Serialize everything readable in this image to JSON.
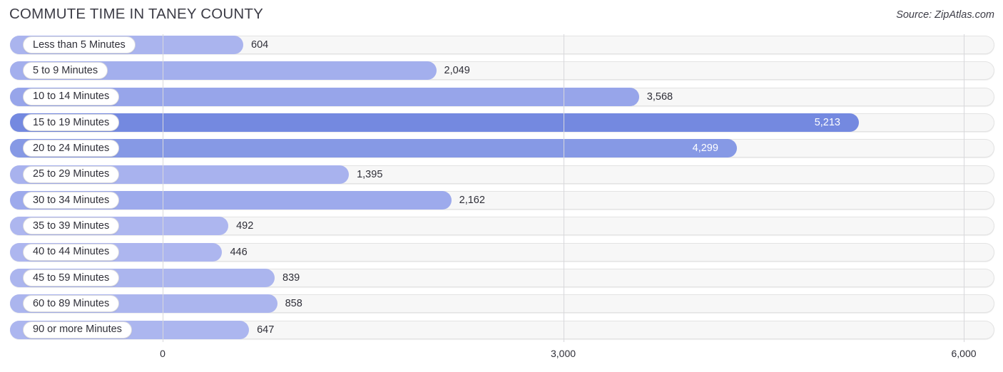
{
  "header": {
    "title": "COMMUTE TIME IN TANEY COUNTY",
    "source": "Source: ZipAtlas.com"
  },
  "colors": {
    "bar_light": "#aab4ee",
    "bar_mid": "#98a5ea",
    "bar_dark": "#7489e0",
    "track": "#f7f7f7",
    "track_border": "#e3e3e3",
    "gridline": "#d8d8dc",
    "text": "#2f2f38",
    "title": "#3c3c46"
  },
  "chart_data": {
    "type": "bar",
    "orientation": "horizontal",
    "title": "COMMUTE TIME IN TANEY COUNTY",
    "xlabel": "",
    "ylabel": "",
    "xlim": [
      0,
      6000
    ],
    "grid": true,
    "legend": false,
    "source": "Source: ZipAtlas.com",
    "categories": [
      "Less than 5 Minutes",
      "5 to 9 Minutes",
      "10 to 14 Minutes",
      "15 to 19 Minutes",
      "20 to 24 Minutes",
      "25 to 29 Minutes",
      "30 to 34 Minutes",
      "35 to 39 Minutes",
      "40 to 44 Minutes",
      "45 to 59 Minutes",
      "60 to 89 Minutes",
      "90 or more Minutes"
    ],
    "values": [
      604,
      2049,
      3568,
      5213,
      4299,
      1395,
      2162,
      492,
      446,
      839,
      858,
      647
    ],
    "value_labels": [
      "604",
      "2,049",
      "3,568",
      "5,213",
      "4,299",
      "1,395",
      "2,162",
      "492",
      "446",
      "839",
      "858",
      "647"
    ],
    "xticks": [
      0,
      3000,
      6000
    ],
    "xtick_labels": [
      "0",
      "3,000",
      "6,000"
    ]
  },
  "rows": [
    {
      "label": "Less than 5 Minutes",
      "value": 604,
      "value_label": "604",
      "color": "#aab4ee",
      "label_inside_bar": false
    },
    {
      "label": "5 to 9 Minutes",
      "value": 2049,
      "value_label": "2,049",
      "color": "#a3afed",
      "label_inside_bar": false
    },
    {
      "label": "10 to 14 Minutes",
      "value": 3568,
      "value_label": "3,568",
      "color": "#97a5ea",
      "label_inside_bar": false
    },
    {
      "label": "15 to 19 Minutes",
      "value": 5213,
      "value_label": "5,213",
      "color": "#7489e0",
      "label_inside_bar": true
    },
    {
      "label": "20 to 24 Minutes",
      "value": 4299,
      "value_label": "4,299",
      "color": "#8699e5",
      "label_inside_bar": true
    },
    {
      "label": "25 to 29 Minutes",
      "value": 1395,
      "value_label": "1,395",
      "color": "#a8b2ee",
      "label_inside_bar": false
    },
    {
      "label": "30 to 34 Minutes",
      "value": 2162,
      "value_label": "2,162",
      "color": "#9daaec",
      "label_inside_bar": false
    },
    {
      "label": "35 to 39 Minutes",
      "value": 492,
      "value_label": "492",
      "color": "#adb6ef",
      "label_inside_bar": false
    },
    {
      "label": "40 to 44 Minutes",
      "value": 446,
      "value_label": "446",
      "color": "#adb6ef",
      "label_inside_bar": false
    },
    {
      "label": "45 to 59 Minutes",
      "value": 839,
      "value_label": "839",
      "color": "#abb5ee",
      "label_inside_bar": false
    },
    {
      "label": "60 to 89 Minutes",
      "value": 858,
      "value_label": "858",
      "color": "#abb5ee",
      "label_inside_bar": false
    },
    {
      "label": "90 or more Minutes",
      "value": 647,
      "value_label": "647",
      "color": "#acb6ef",
      "label_inside_bar": false
    }
  ],
  "axis": {
    "ticks": [
      {
        "label": "0",
        "value": 0
      },
      {
        "label": "3,000",
        "value": 3000
      },
      {
        "label": "6,000",
        "value": 6000
      }
    ]
  }
}
